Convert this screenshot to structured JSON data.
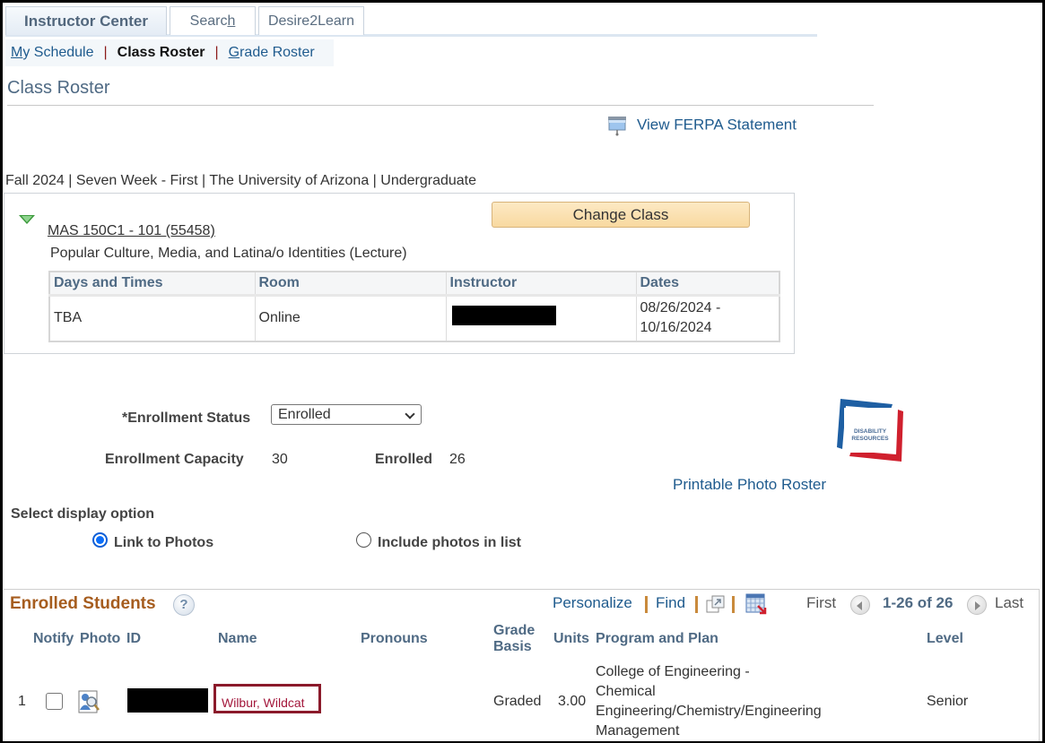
{
  "tabs": [
    {
      "label": "Instructor Center",
      "active": true
    },
    {
      "label": "Search",
      "active": false,
      "accesskey_char": "h"
    },
    {
      "label": "Desire2Learn",
      "active": false
    }
  ],
  "tab_search_prefix": "Searc",
  "tab_search_suffix": "h",
  "subnav": {
    "items": [
      {
        "label": "My Schedule",
        "current": false
      },
      {
        "label": "Class Roster",
        "current": true
      },
      {
        "label": "Grade Roster",
        "current": false
      }
    ],
    "separator": "|"
  },
  "page_title": "Class Roster",
  "ferpa_link": "View FERPA Statement",
  "term_line": "Fall 2024 | Seven Week - First | The University of Arizona | Undergraduate",
  "class_info": {
    "class_link": "MAS 150C1 - 101 (55458)",
    "description": "Popular Culture, Media, and Latina/o Identities (Lecture)",
    "change_class_button": "Change Class",
    "meeting_table": {
      "headers": [
        "Days and Times",
        "Room",
        "Instructor",
        "Dates"
      ],
      "rows": [
        {
          "days_times": "TBA",
          "room": "Online",
          "instructor": "[redacted]",
          "dates_line1": "08/26/2024 -",
          "dates_line2": "10/16/2024"
        }
      ]
    }
  },
  "enrollment": {
    "status_label": "*Enrollment Status",
    "status_value": "Enrolled",
    "capacity_label": "Enrollment Capacity",
    "capacity_value": "30",
    "enrolled_label": "Enrolled",
    "enrolled_value": "26"
  },
  "disability_logo": {
    "line1": "DISABILITY",
    "line2": "RESOURCES"
  },
  "printable_photo_roster": "Printable Photo Roster",
  "display_option": {
    "label": "Select display option",
    "options": [
      {
        "label": "Link to Photos",
        "selected": true
      },
      {
        "label": "Include photos in list",
        "selected": false
      }
    ]
  },
  "grid": {
    "title": "Enrolled Students",
    "help_icon": "?",
    "personalize": "Personalize",
    "find": "Find",
    "first": "First",
    "range": "1-26 of 26",
    "last": "Last",
    "columns": {
      "notify": "Notify",
      "photo": "Photo",
      "id": "ID",
      "name": "Name",
      "pronouns": "Pronouns",
      "grade_basis_1": "Grade",
      "grade_basis_2": "Basis",
      "units": "Units",
      "program_plan": "Program and Plan",
      "level": "Level"
    },
    "rows": [
      {
        "num": "1",
        "notify_checked": false,
        "id": "[redacted]",
        "name": "Wilbur, Wildcat",
        "pronouns": "",
        "grade_basis": "Graded",
        "units": "3.00",
        "program_plan_lines": [
          "College of Engineering -",
          "Chemical",
          "Engineering/Chemistry/Engineering",
          "Management"
        ],
        "level": "Senior"
      }
    ]
  },
  "colors": {
    "link": "#1f5b8e",
    "header_text": "#4f6a84",
    "grid_title": "#a65d1f",
    "name_highlight": "#8b1a2b",
    "button_bg": "#f8d9a0"
  }
}
